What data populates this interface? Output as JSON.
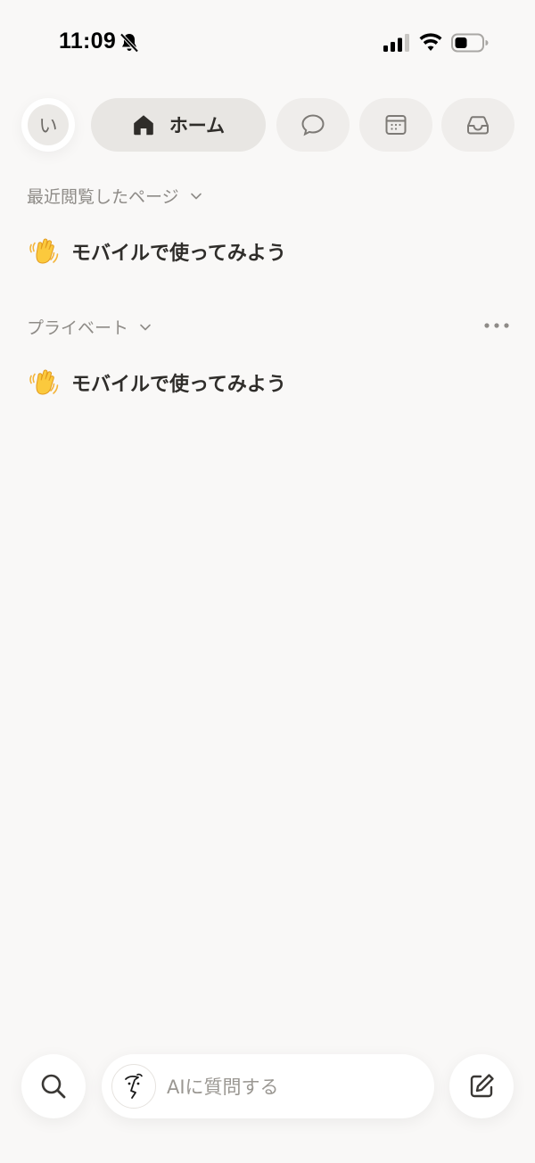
{
  "status_bar": {
    "time": "11:09",
    "icons": [
      "bell-slash-icon",
      "cellular-signal-icon",
      "wifi-icon",
      "battery-icon"
    ]
  },
  "nav": {
    "avatar_initial": "い",
    "home_label": "ホーム",
    "home_icon": "home-icon",
    "chat_icon": "chat-bubble-icon",
    "calendar_icon": "calendar-icon",
    "inbox_icon": "inbox-icon"
  },
  "recent": {
    "header": "最近閲覧したページ",
    "items": [
      {
        "icon": "waving-hand-emoji",
        "title": "モバイルで使ってみよう"
      }
    ]
  },
  "private": {
    "header": "プライベート",
    "items": [
      {
        "icon": "waving-hand-emoji",
        "title": "モバイルで使ってみよう"
      }
    ]
  },
  "bottom_bar": {
    "ai_placeholder": "AIに質問する",
    "search_icon": "search-icon",
    "compose_icon": "compose-icon"
  },
  "colors": {
    "background": "#f9f8f7",
    "pill": "#efedeb",
    "active_pill": "#e8e6e3",
    "text": "#2f2d2a",
    "muted": "#8e8b87"
  }
}
